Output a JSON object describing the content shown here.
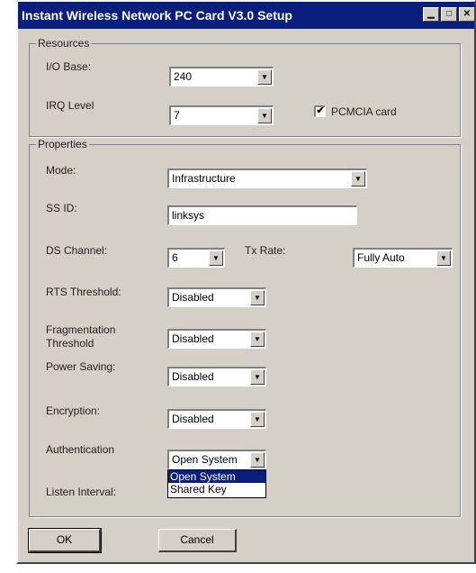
{
  "window": {
    "title": "Instant Wireless Network PC Card V3.0 Setup"
  },
  "resources": {
    "group_label": "Resources",
    "io_base": {
      "label": "I/O Base:",
      "value": "240"
    },
    "irq_level": {
      "label": "IRQ Level",
      "value": "7"
    },
    "pcmcia": {
      "label": "PCMCIA card",
      "checked": true,
      "mark": "✔"
    }
  },
  "properties": {
    "group_label": "Properties",
    "mode": {
      "label": "Mode:",
      "value": "Infrastructure"
    },
    "ssid": {
      "label": "SS ID:",
      "value": "linksys"
    },
    "ds_channel": {
      "label": "DS Channel:",
      "value": "6"
    },
    "tx_rate": {
      "label": "Tx Rate:",
      "value": "Fully Auto"
    },
    "rts_threshold": {
      "label": "RTS Threshold:",
      "value": "Disabled"
    },
    "fragmentation": {
      "label_line1": "Fragmentation",
      "label_line2": "Threshold",
      "value": "Disabled"
    },
    "power_saving": {
      "label": "Power Saving:",
      "value": "Disabled"
    },
    "encryption": {
      "label": "Encryption:",
      "value": "Disabled"
    },
    "authentication": {
      "label": "Authentication",
      "value": "Open System",
      "options": [
        "Open System",
        "Shared Key"
      ],
      "highlighted_option": "Open System"
    },
    "listen_interval": {
      "label": "Listen Interval:"
    }
  },
  "buttons": {
    "ok": "OK",
    "cancel": "Cancel"
  },
  "icons": {
    "dropdown_arrow": "▼",
    "minimize": "▁",
    "maximize": "□",
    "close": "✕"
  }
}
